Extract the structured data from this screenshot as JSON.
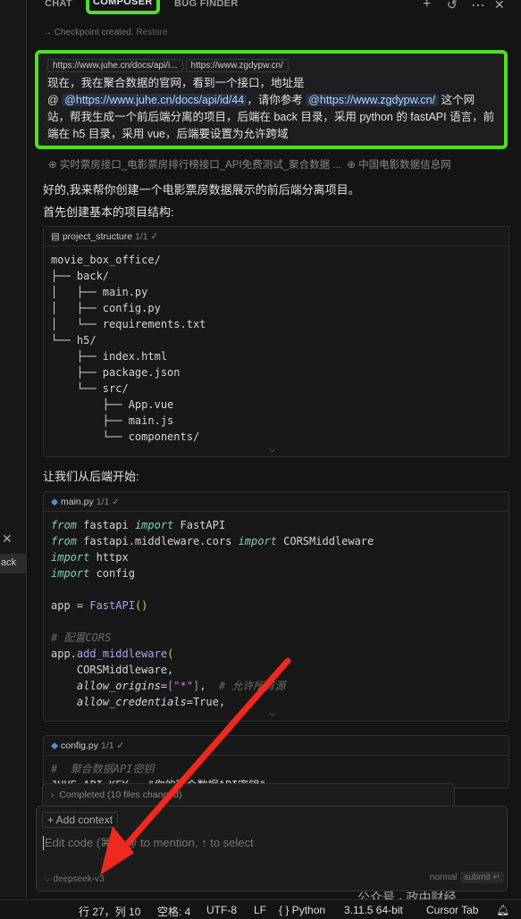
{
  "tabs": [
    {
      "label": "CHAT"
    },
    {
      "label": "COMPOSER"
    },
    {
      "label": "BUG FINDER"
    }
  ],
  "tab_icons": [
    "plus-icon",
    "history-icon",
    "more-icon",
    "close-icon"
  ],
  "checkpoint": {
    "text": "→ Checkpoint created.",
    "restore": "Restore"
  },
  "message": {
    "pills": [
      "https://www.juhe.cn/docs/api/i...",
      "https://www.zgdypw.cn/"
    ],
    "line1": "现在，我在聚合数据的官网，看到一个接口，地址是",
    "at": "@",
    "mention1": "@https://www.juhe.cn/docs/api/id/44",
    "mid": "，请你参考 ",
    "mention2": "@https://www.zgdypw.cn/",
    "rest": " 这个网站，帮我生成一个前后端分离的项目，后端在 back 目录，采用 python 的 fastAPI 语言，前端在 h5 目录，采用 vue，后端要设置为允许跨域"
  },
  "refs": [
    "实时票房接口_电影票房排行榜接口_API免费测试_聚合数据 ...",
    "中国电影数据信息网"
  ],
  "reply": {
    "p1": "好的,我来帮你创建一个电影票房数据展示的前后端分离项目。",
    "p2": "首先创建基本的项目结构:",
    "p3": "让我们从后端开始:"
  },
  "blocks": [
    {
      "name": "project_structure",
      "count": "1/1 ✓"
    },
    {
      "name": "main.py",
      "count": "1/1 ✓"
    },
    {
      "name": "config.py",
      "count": "1/1 ✓"
    }
  ],
  "tree": "movie_box_office/\n├── back/\n│   ├── main.py\n│   ├── config.py\n│   └── requirements.txt\n└── h5/\n    ├── index.html\n    ├── package.json\n    └── src/\n        ├── App.vue\n        ├── main.js\n        └── components/",
  "config_comment": "#  聚合数据API密钥",
  "config_line": "JUHE_API_KEY = \"你的聚合数据API密钥\"",
  "completed": "Completed (10 files changed)",
  "input": {
    "add_context": "+ Add context",
    "placeholder": "Edit code (⌘I), @ to mention, ↑ to select",
    "model": "⌵ deepseek-v3",
    "mode": "normal",
    "submit": "submit ↵"
  },
  "left_panel": {
    "label": "ack"
  },
  "status": {
    "position": "行 27，列 10",
    "spaces": "空格: 4",
    "encoding": "UTF-8",
    "eol": "LF",
    "lang": "{ } Python",
    "interp": "3.11.5 64-bit",
    "tab": "Cursor Tab"
  },
  "watermark": "公众号 · 政中财经",
  "colors": {
    "highlight": "#4ee021",
    "arrow": "#f0281e"
  }
}
